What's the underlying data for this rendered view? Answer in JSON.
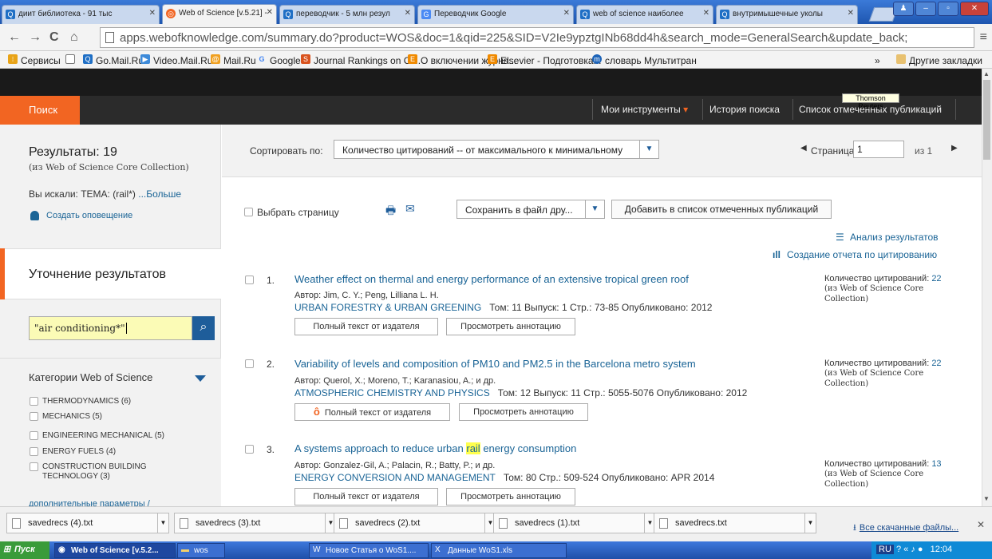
{
  "browser": {
    "tabs": [
      {
        "label": "диит библиотека - 91 тыс"
      },
      {
        "label": "Web of Science [v.5.21] -"
      },
      {
        "label": "переводчик - 5 млн резул"
      },
      {
        "label": "Переводчик Google"
      },
      {
        "label": "web of science наиболее"
      },
      {
        "label": "внутримышечные уколы"
      }
    ],
    "url": "apps.webofknowledge.com/summary.do?product=WOS&doc=1&qid=225&SID=V2Ie9ypztgINb68dd4h&search_mode=GeneralSearch&update_back;",
    "bookmarks": [
      {
        "label": "Сервисы"
      },
      {
        "label": "Go.Mail.Ru"
      },
      {
        "label": "Video.Mail.Ru"
      },
      {
        "label": "Mail.Ru"
      },
      {
        "label": "Google"
      },
      {
        "label": "Journal Rankings on Ci..."
      },
      {
        "label": "О включении журна..."
      },
      {
        "label": "Elsevier - Подготовка..."
      },
      {
        "label": "словарь Мультитран"
      }
    ],
    "other_bookmarks": "Другие закладки",
    "bookmarks_more": "»"
  },
  "header": {
    "search_tab": "Поиск",
    "my_tools": "Мои инструменты",
    "history": "История поиска",
    "marked_list": "Список отмеченных публикаций",
    "tooltip": "Thomson Reuters"
  },
  "sidebar": {
    "results_title": "Результаты: 19",
    "results_sub": "(из Web of Science Core Collection)",
    "searched_prefix": "Вы искали: ТЕМА: (rail*) ",
    "searched_more": "...Больше",
    "create_alert": "Создать оповещение",
    "refine_title": "Уточнение результатов",
    "refine_value": "\"air conditioning*\"",
    "categories_title": "Категории Web of Science",
    "categories": [
      {
        "label": "THERMODYNAMICS (6)"
      },
      {
        "label": "MECHANICS (5)"
      },
      {
        "label": "ENGINEERING MECHANICAL (5)"
      },
      {
        "label": "ENERGY FUELS (4)"
      },
      {
        "label": "CONSTRUCTION BUILDING TECHNOLOGY (3)"
      }
    ],
    "more_params": "дополнительные параметры /"
  },
  "sortbar": {
    "label": "Сортировать по:",
    "value": "Количество цитирований -- от максимального к минимальному",
    "page_label": "Страница",
    "page_value": "1",
    "page_of": "из  1"
  },
  "toolbar": {
    "select_page": "Выбрать страницу",
    "save_to_file": "Сохранить в файл дру...",
    "add_marked": "Добавить в список отмеченных публикаций",
    "analysis": "Анализ результатов",
    "citation_report": "Создание отчета по цитированию"
  },
  "records": [
    {
      "num": "1.",
      "title": "Weather effect on thermal and energy performance of an extensive tropical green roof",
      "authors": "Автор: Jim, C. Y.; Peng, Lilliana L. H.",
      "journal": "URBAN FORESTRY & URBAN GREENING",
      "details": "Том: 11   Выпуск: 1   Стр.: 73-85   Опубликовано: 2012",
      "btn_fulltext": "Полный текст от издателя",
      "btn_abstract": "Просмотреть аннотацию",
      "cites_label": "Количество цитирований: ",
      "cites_count": "22",
      "cites_source": "(из Web of Science Core Collection)"
    },
    {
      "num": "2.",
      "title": "Variability of levels and composition of PM10 and PM2.5 in the Barcelona metro system",
      "authors": "Автор: Querol, X.; Moreno, T.; Karanasiou, A.; и др.",
      "journal": "ATMOSPHERIC CHEMISTRY AND PHYSICS",
      "details": "Том: 12   Выпуск: 11   Стр.: 5055-5076   Опубликовано: 2012",
      "btn_fulltext": "Полный текст от издателя",
      "btn_abstract": "Просмотреть аннотацию",
      "cites_label": "Количество цитирований: ",
      "cites_count": "22",
      "cites_source": "(из Web of Science Core Collection)"
    },
    {
      "num": "3.",
      "title_before": "A systems approach to reduce urban ",
      "title_hl": "rail",
      "title_after": " energy consumption",
      "authors": "Автор: Gonzalez-Gil, A.; Palacin, R.; Batty, P.; и др.",
      "journal": "ENERGY CONVERSION AND MANAGEMENT",
      "details": "Том: 80   Стр.: 509-524   Опубликовано: APR 2014",
      "btn_fulltext": "Полный текст от издателя",
      "btn_abstract": "Просмотреть аннотацию",
      "cites_label": "Количество цитирований: ",
      "cites_count": "13",
      "cites_source": "(из Web of Science Core Collection)"
    }
  ],
  "downloads": [
    {
      "name": "savedrecs (4).txt"
    },
    {
      "name": "savedrecs (3).txt"
    },
    {
      "name": "savedrecs (2).txt"
    },
    {
      "name": "savedrecs (1).txt"
    },
    {
      "name": "savedrecs.txt"
    }
  ],
  "all_downloads": "Все скачанные файлы...",
  "taskbar": {
    "start": "Пуск",
    "tasks": [
      {
        "label": "Web of Science [v.5.2..."
      },
      {
        "label": "wos"
      },
      {
        "label": "Новое Статья о WoS1...."
      },
      {
        "label": "Данные WoS1.xls"
      }
    ],
    "lang": "RU",
    "clock": "12:04"
  },
  "colors": {
    "accent": "#f26522",
    "link": "#1a6496",
    "nav_bg": "#2b2b2b",
    "highlight": "#ffff4d"
  }
}
